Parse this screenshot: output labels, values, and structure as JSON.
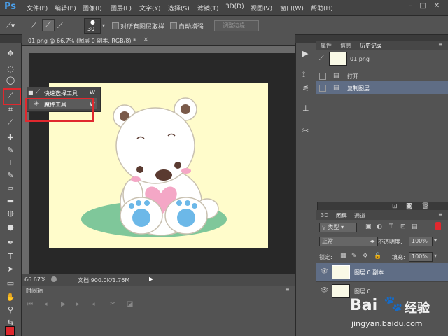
{
  "app": {
    "logo": "Ps"
  },
  "menubar": {
    "items": [
      "文件(F)",
      "编辑(E)",
      "图像(I)",
      "图层(L)",
      "文字(Y)",
      "选择(S)",
      "滤镜(T)",
      "3D(D)",
      "视图(V)",
      "窗口(W)",
      "帮助(H)"
    ]
  },
  "options": {
    "brush_size": "30",
    "sample_all_layers": "对所有图层取样",
    "auto_enhance": "自动增强",
    "refine_edge": "调整边缘..."
  },
  "document": {
    "tab_title": "01.png @ 66.7% (图层 0 副本, RGB/8) *",
    "zoom": "66.67%",
    "doc_size": "文档:900.0K/1.76M"
  },
  "flyout": {
    "items": [
      {
        "label": "快速选择工具",
        "shortcut": "W"
      },
      {
        "label": "魔棒工具",
        "shortcut": "W"
      }
    ]
  },
  "timeline": {
    "title": "时间轴"
  },
  "history": {
    "tabs": [
      "属性",
      "信息",
      "历史记录"
    ],
    "snapshot": "01.png",
    "items": [
      "打开",
      "复制图层"
    ]
  },
  "layers": {
    "tabs": [
      "3D",
      "图层",
      "通道"
    ],
    "filter": "类型",
    "blend_mode": "正常",
    "opacity_label": "不透明度:",
    "opacity_value": "100%",
    "lock_label": "锁定:",
    "fill_label": "填充:",
    "fill_value": "100%",
    "items": [
      "图层 0 副本",
      "图层 0"
    ]
  },
  "watermark": {
    "brand": "Bai",
    "brand2": "经验",
    "url": "jingyan.baidu.com"
  },
  "colors": {
    "highlight": "#e0282e",
    "selection": "#5f6d85",
    "canvas_bg": "#fffccb",
    "accent": "#4a9ee8"
  }
}
